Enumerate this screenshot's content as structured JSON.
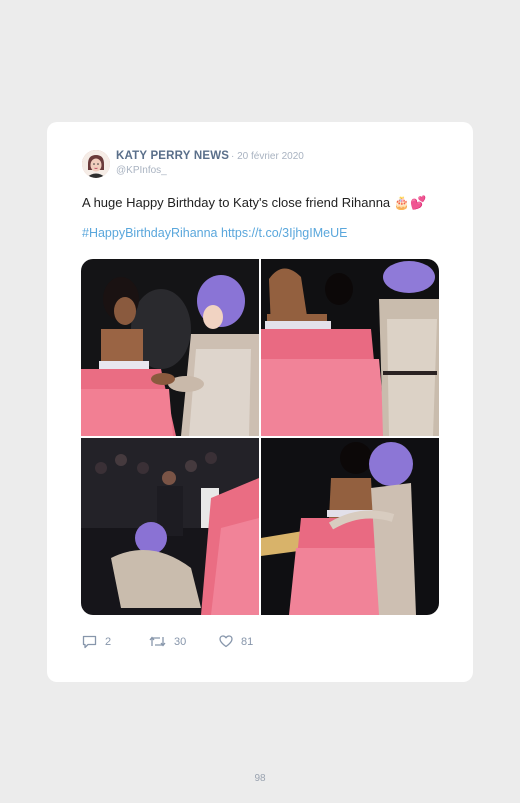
{
  "tweet": {
    "author_name": "KATY PERRY NEWS",
    "date": "· 20 février 2020",
    "handle": "@KPInfos_",
    "text": "A huge Happy Birthday to Katy's close friend Rihanna",
    "emoji_cake": "🎂",
    "emoji_heart": "💕",
    "hashtag": "#HappyBirthdayRihanna",
    "link": "https://t.co/3IjhgIMeUE"
  },
  "stats": {
    "replies": "2",
    "retweets": "30",
    "likes": "81"
  },
  "icons": {
    "reply": "speech-bubble-icon",
    "retweet": "retweet-arrows-icon",
    "like": "heart-icon"
  },
  "page": {
    "number": "98"
  },
  "colors": {
    "background": "#ececec",
    "card": "#ffffff",
    "name": "#5a6f8a",
    "link": "#5aa7dc",
    "muted": "#a9b3c1"
  }
}
